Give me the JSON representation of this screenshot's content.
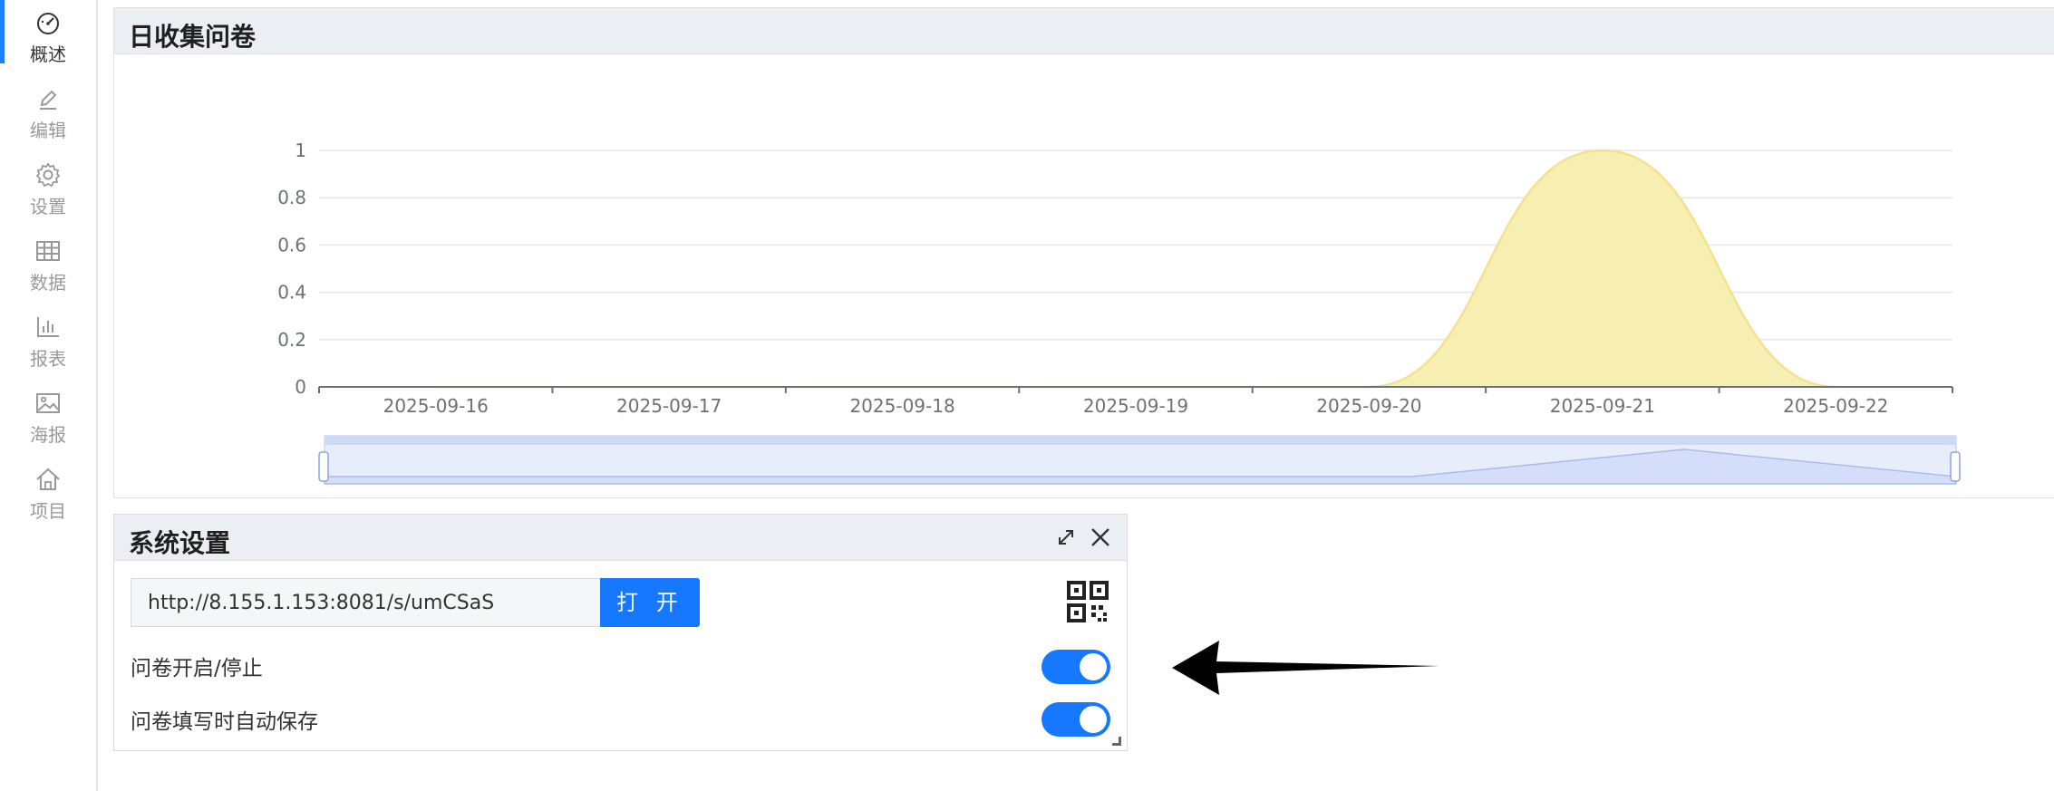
{
  "sidebar": {
    "items": [
      {
        "label": "概述",
        "icon": "dashboard-icon",
        "active": true
      },
      {
        "label": "编辑",
        "icon": "edit-icon",
        "active": false
      },
      {
        "label": "设置",
        "icon": "gear-icon",
        "active": false
      },
      {
        "label": "数据",
        "icon": "table-icon",
        "active": false
      },
      {
        "label": "报表",
        "icon": "bar-chart-icon",
        "active": false
      },
      {
        "label": "海报",
        "icon": "image-icon",
        "active": false
      },
      {
        "label": "项目",
        "icon": "home-icon",
        "active": false
      }
    ]
  },
  "chart_panel": {
    "title": "日收集问卷"
  },
  "chart_data": {
    "type": "area",
    "title": "日收集问卷",
    "categories": [
      "2025-09-16",
      "2025-09-17",
      "2025-09-18",
      "2025-09-19",
      "2025-09-20",
      "2025-09-21",
      "2025-09-22"
    ],
    "values": [
      0,
      0,
      0,
      0,
      0,
      1,
      0
    ],
    "y_ticks": [
      "0",
      "0.2",
      "0.4",
      "0.6",
      "0.8",
      "1"
    ],
    "ylim": [
      0,
      1
    ],
    "series_color": "#f7efb2",
    "series_stroke": "#f2e28a",
    "grid": true,
    "data_zoom": true
  },
  "settings_panel": {
    "title": "系统设置",
    "url_value": "http://8.155.1.153:8081/s/umCSaS",
    "open_button": "打 开",
    "toggle_1_label": "问卷开启/停止",
    "toggle_1_on": true,
    "toggle_2_label": "问卷填写时自动保存",
    "toggle_2_on": true
  },
  "colors": {
    "accent": "#1677ff",
    "header_bg": "#ebeef2",
    "zoom_fill": "#dfe7fb"
  }
}
